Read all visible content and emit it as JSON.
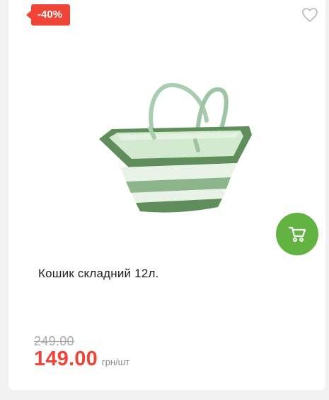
{
  "product": {
    "discount_badge": "-40%",
    "title": "Кошик складний 12л.",
    "old_price": "249.00",
    "price": "149.00",
    "unit": "грн/шт"
  },
  "icons": {
    "wishlist": "heart-outline-icon",
    "cart": "shopping-cart-icon"
  },
  "colors": {
    "badge": "#f04437",
    "price": "#f04437",
    "cart_button": "#63b342",
    "basket_dark": "#5c8a5a",
    "basket_light": "#d6ead2"
  }
}
